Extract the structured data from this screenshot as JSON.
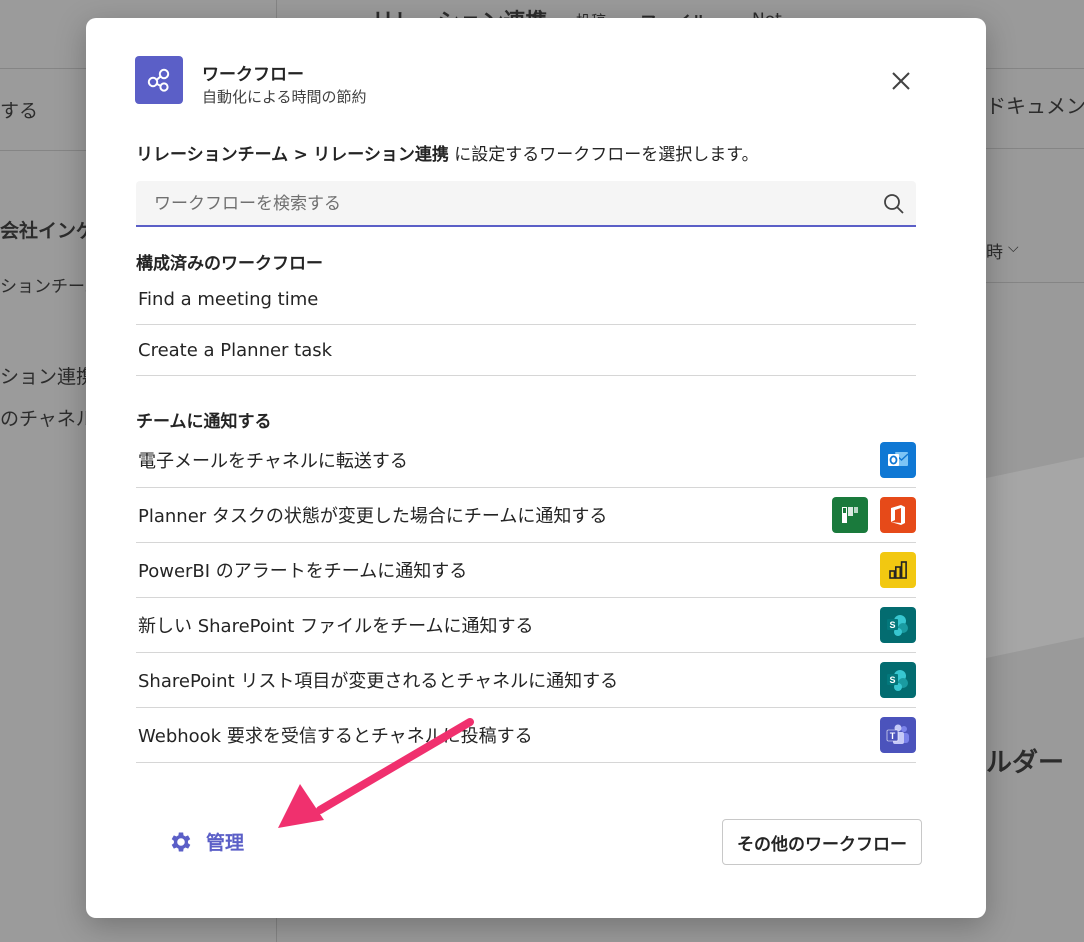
{
  "background": {
    "left_items": [
      "する",
      "会社インゲー",
      "ションチーム",
      "ション連携",
      "のチャネル"
    ],
    "header_title": "リレーション連携",
    "header_tabs": [
      "投稿",
      "ファイル",
      "Not"
    ],
    "right_items": [
      "ドキュメン",
      "時",
      "ルダー"
    ]
  },
  "dialog": {
    "title": "ワークフロー",
    "subtitle": "自動化による時間の節約",
    "close_label": "×",
    "instruction": {
      "team": "リレーションチーム",
      "separator": ">",
      "channel": "リレーション連携",
      "text": "に設定するワークフローを選択します。"
    },
    "search": {
      "placeholder": "ワークフローを検索する",
      "value": ""
    },
    "configured": {
      "heading": "構成済みのワークフロー",
      "items": [
        "Find a meeting time",
        "Create a Planner task"
      ]
    },
    "notify": {
      "heading": "チームに通知する",
      "items": [
        {
          "label": "電子メールをチャネルに転送する",
          "icons": [
            "outlook-icon"
          ]
        },
        {
          "label": "Planner タスクの状態が変更した場合にチームに通知する",
          "icons": [
            "planner-icon",
            "office-icon"
          ]
        },
        {
          "label": "PowerBI のアラートをチームに通知する",
          "icons": [
            "powerbi-icon"
          ]
        },
        {
          "label": "新しい SharePoint ファイルをチームに通知する",
          "icons": [
            "sharepoint-icon"
          ]
        },
        {
          "label": "SharePoint リスト項目が変更されるとチャネルに通知する",
          "icons": [
            "sharepoint-icon"
          ]
        },
        {
          "label": "Webhook 要求を受信するとチャネルに投稿する",
          "icons": [
            "teams-icon"
          ]
        }
      ]
    },
    "manage_label": "管理",
    "more_label": "その他のワークフロー"
  },
  "colors": {
    "accent": "#5b5fc7",
    "outlook": "#0f78d4",
    "planner": "#1a7a3c",
    "office": "#e64a19",
    "powerbi": "#f2c811",
    "sharepoint": "#036c70",
    "teams": "#4b53bc",
    "annotation_arrow": "#f0306e"
  }
}
